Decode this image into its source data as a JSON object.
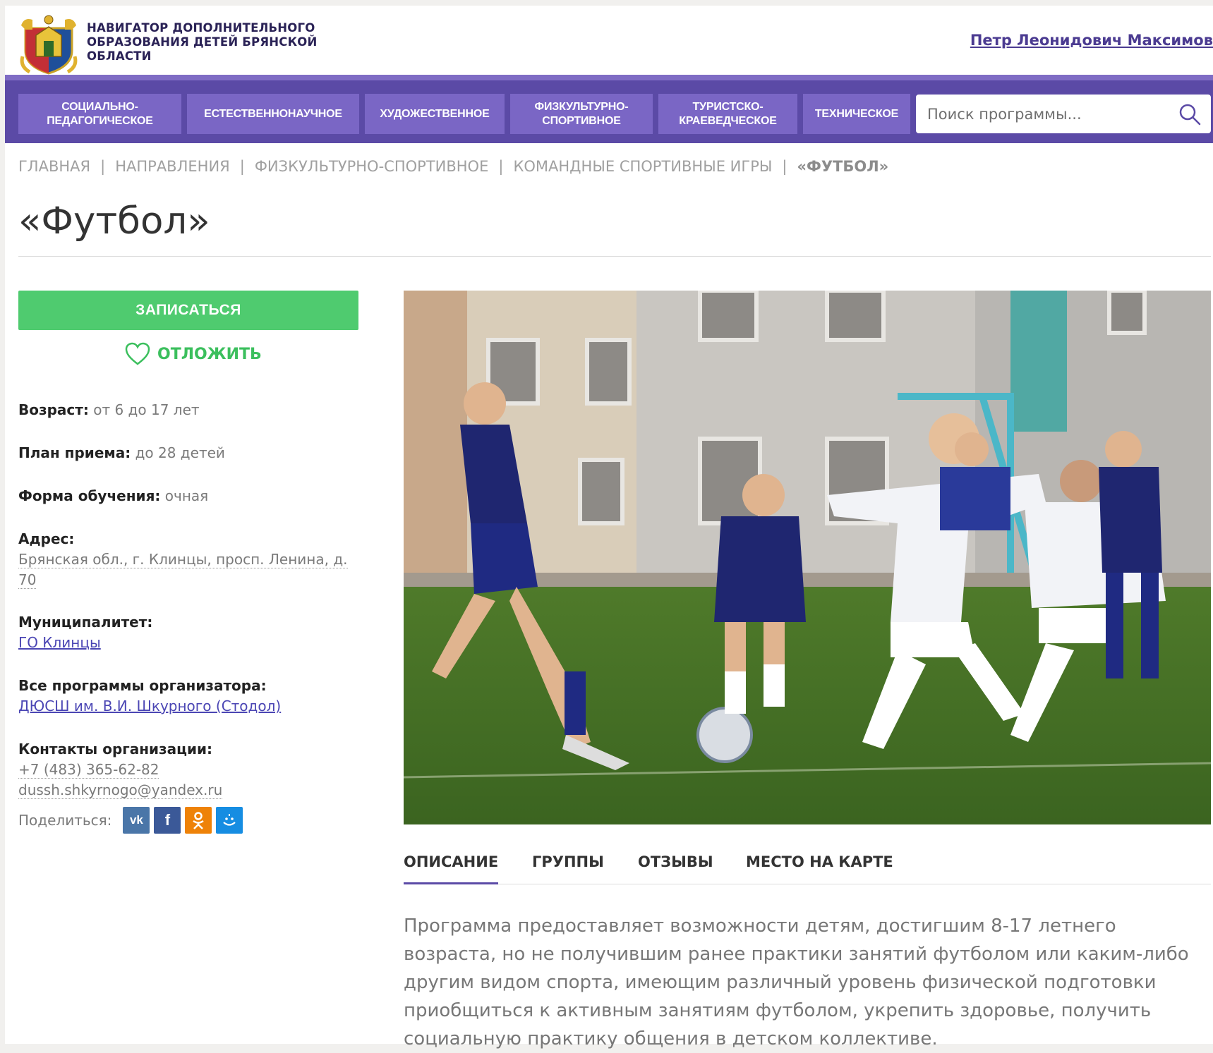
{
  "header": {
    "site_name": "НАВИГАТОР ДОПОЛНИТЕЛЬНОГО ОБРАЗОВАНИЯ ДЕТЕЙ БРЯНСКОЙ ОБЛАСТИ",
    "user_name": "Петр Леонидович Максимов"
  },
  "nav": {
    "items": [
      {
        "label": "СОЦИАЛЬНО-ПЕДАГОГИЧЕСКОЕ"
      },
      {
        "label": "ЕСТЕСТВЕННОНАУЧНОЕ"
      },
      {
        "label": "ХУДОЖЕСТВЕННОЕ"
      },
      {
        "label": "ФИЗКУЛЬТУРНО-СПОРТИВНОЕ"
      },
      {
        "label": "ТУРИСТСКО-КРАЕВЕДЧЕСКОЕ"
      },
      {
        "label": "ТЕХНИЧЕСКОЕ"
      }
    ],
    "search_placeholder": "Поиск программы..."
  },
  "breadcrumb": {
    "items": [
      "ГЛАВНАЯ",
      "НАПРАВЛЕНИЯ",
      "ФИЗКУЛЬТУРНО-СПОРТИВНОЕ",
      "КОМАНДНЫЕ СПОРТИВНЫЕ ИГРЫ"
    ],
    "current": "«ФУТБОЛ»"
  },
  "page_title": "«Футбол»",
  "actions": {
    "enroll": "ЗАПИСАТЬСЯ",
    "defer": "ОТЛОЖИТЬ"
  },
  "info": {
    "age_label": "Возраст:",
    "age_value": "от 6 до 17 лет",
    "plan_label": "План приема:",
    "plan_value": "до 28 детей",
    "form_label": "Форма обучения:",
    "form_value": "очная",
    "address_label": "Адрес:",
    "address_line1": "Брянская обл., г. Клинцы, просп. Ленина, д.",
    "address_line2": "70",
    "municipality_label": "Муниципалитет:",
    "municipality_value": "ГО Клинцы",
    "organizer_label": "Все программы организатора:",
    "organizer_value": "ДЮСШ им. В.И. Шкурного (Стодол)",
    "contacts_label": "Контакты организации:",
    "phone": "+7 (483) 365-62-82",
    "email": "dussh.shkyrnogo@yandex.ru",
    "share_label": "Поделиться:"
  },
  "social": [
    {
      "name": "vk-icon",
      "color": "#4a76a8"
    },
    {
      "name": "facebook-icon",
      "color": "#3b5998"
    },
    {
      "name": "odnoklassniki-icon",
      "color": "#ee8208"
    },
    {
      "name": "mail-ru-icon",
      "color": "#168de2"
    }
  ],
  "tabs": {
    "items": [
      "ОПИСАНИЕ",
      "ГРУППЫ",
      "ОТЗЫВЫ",
      "МЕСТО НА КАРТЕ"
    ],
    "active": "ОПИСАНИЕ"
  },
  "description": "Программа предоставляет возможности детям, достигшим 8-17 летнего возраста, но не получившим ранее практики занятий футболом или каким-либо другим видом спорта, имеющим различный уровень физической подготовки приобщиться к активным занятиям футболом, укрепить здоровье, получить социальную практику общения в детском коллективе.",
  "colors": {
    "nav_bg": "#5b4aa6",
    "nav_item": "#7a66c5",
    "enroll": "#4fcb6f",
    "defer": "#3bbf5d",
    "link": "#4b46b4"
  }
}
